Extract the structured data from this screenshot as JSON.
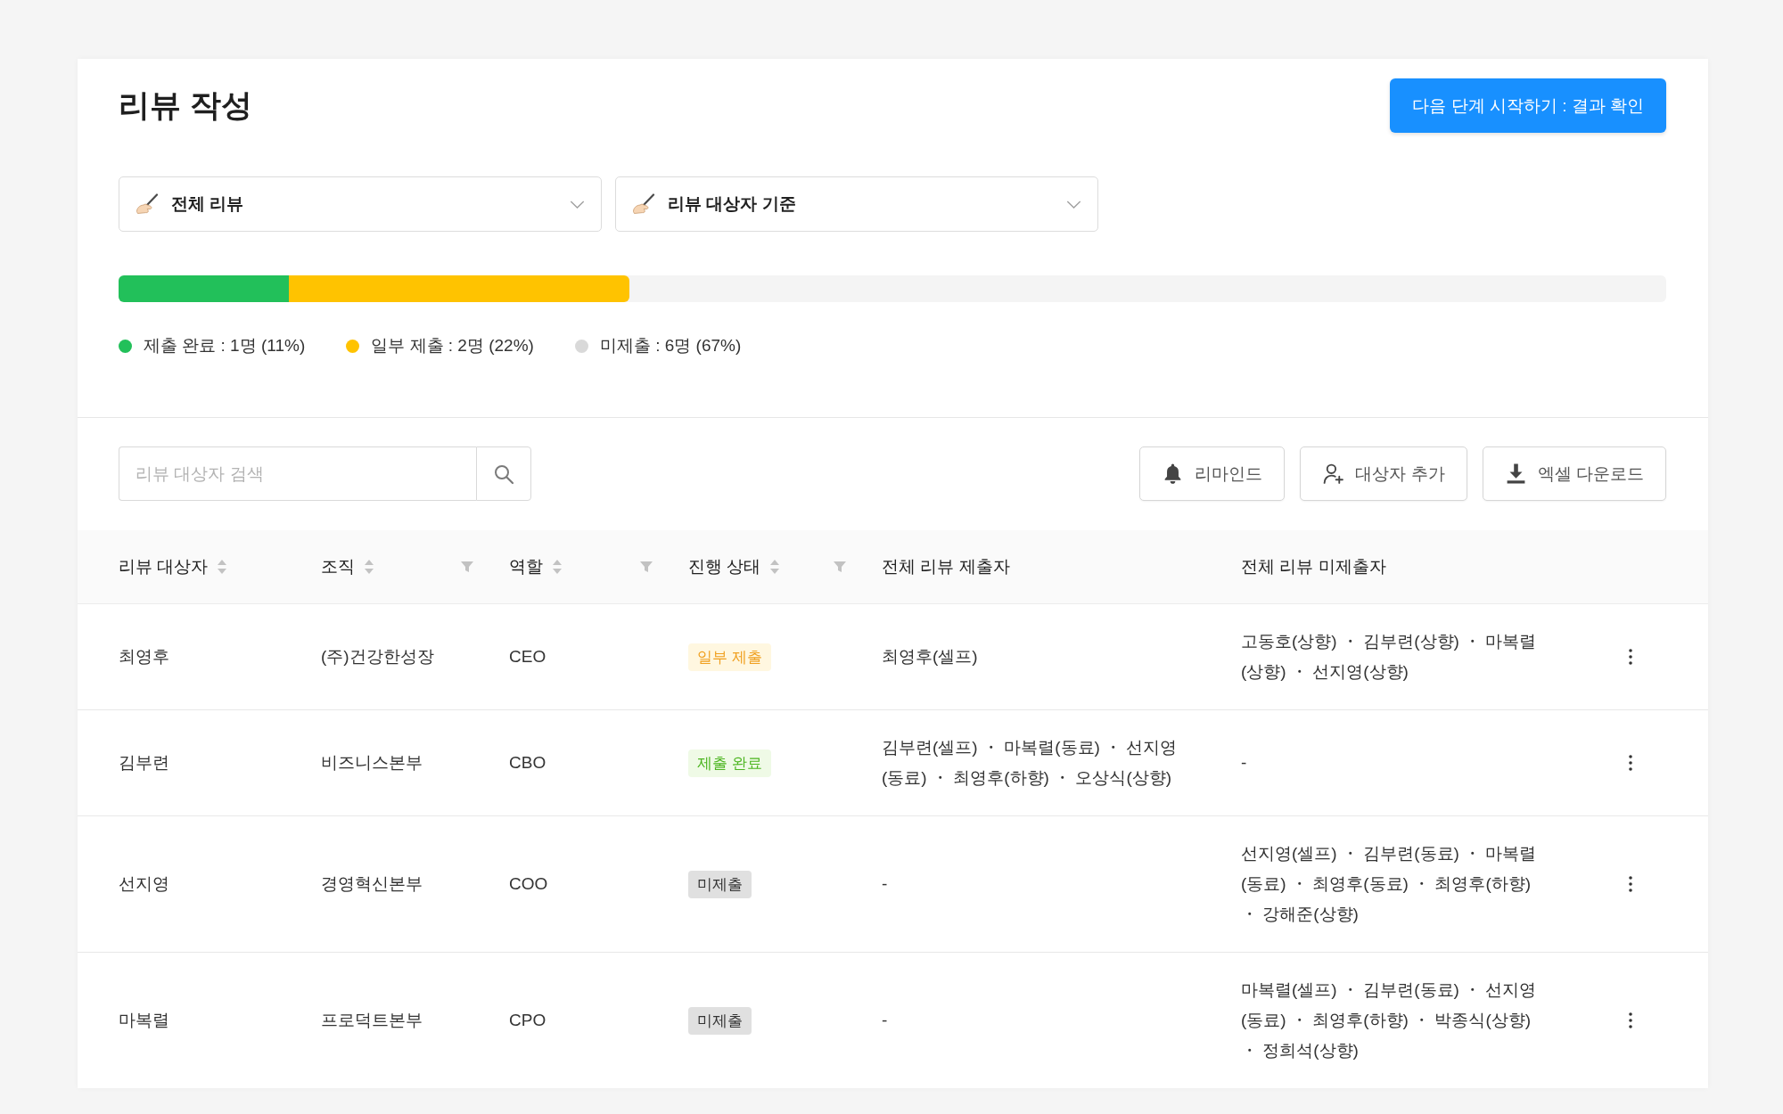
{
  "page": {
    "title": "리뷰 작성",
    "next_step_button": "다음 단계 시작하기 : 결과 확인"
  },
  "dropdowns": [
    {
      "label": "전체 리뷰"
    },
    {
      "label": "리뷰 대상자 기준"
    }
  ],
  "progress": {
    "segments": [
      {
        "level": 0.11,
        "color": "#22c05a"
      },
      {
        "level": 0.22,
        "color": "#ffc300"
      }
    ]
  },
  "legend": [
    {
      "label": "제출 완료 : 1명 (11%)",
      "color": "#22c05a"
    },
    {
      "label": "일부 제출 : 2명 (22%)",
      "color": "#ffc300"
    },
    {
      "label": "미제출 : 6명 (67%)",
      "color": "#d9d9d9"
    }
  ],
  "search": {
    "placeholder": "리뷰 대상자 검색"
  },
  "toolbar": {
    "remind_button": "리마인드",
    "add_target_button": "대상자 추가",
    "excel_download_button": "엑셀 다운로드"
  },
  "table": {
    "columns": [
      {
        "label": "리뷰 대상자",
        "sort": true,
        "filter": false
      },
      {
        "label": "조직",
        "sort": true,
        "filter": true
      },
      {
        "label": "역할",
        "sort": true,
        "filter": true
      },
      {
        "label": "진행 상태",
        "sort": true,
        "filter": true
      },
      {
        "label": "전체 리뷰 제출자",
        "sort": false,
        "filter": false
      },
      {
        "label": "전체 리뷰 미제출자",
        "sort": false,
        "filter": false
      }
    ],
    "rows": [
      {
        "name": "최영후",
        "org": "(주)건강한성장",
        "role": "CEO",
        "status": {
          "label": "일부 제출",
          "kind": "partial"
        },
        "submitters": "최영후(셀프)",
        "non_submitters": "고동호(상향) ・ 김부련(상향) ・ 마복렬(상향) ・ 선지영(상향)"
      },
      {
        "name": "김부련",
        "org": "비즈니스본부",
        "role": "CBO",
        "status": {
          "label": "제출 완료",
          "kind": "done"
        },
        "submitters": "김부련(셀프) ・ 마복렬(동료) ・ 선지영(동료) ・ 최영후(하향) ・ 오상식(상향)",
        "non_submitters": "-"
      },
      {
        "name": "선지영",
        "org": "경영혁신본부",
        "role": "COO",
        "status": {
          "label": "미제출",
          "kind": "none"
        },
        "submitters": "-",
        "non_submitters": "선지영(셀프) ・ 김부련(동료) ・ 마복렬(동료) ・ 최영후(동료) ・ 최영후(하향) ・ 강해준(상향)"
      },
      {
        "name": "마복렬",
        "org": "프로덕트본부",
        "role": "CPO",
        "status": {
          "label": "미제출",
          "kind": "none"
        },
        "submitters": "-",
        "non_submitters": "마복렬(셀프) ・ 김부련(동료) ・ 선지영(동료) ・ 최영후(하향) ・ 박종식(상향) ・ 정희석(상향)"
      }
    ]
  }
}
